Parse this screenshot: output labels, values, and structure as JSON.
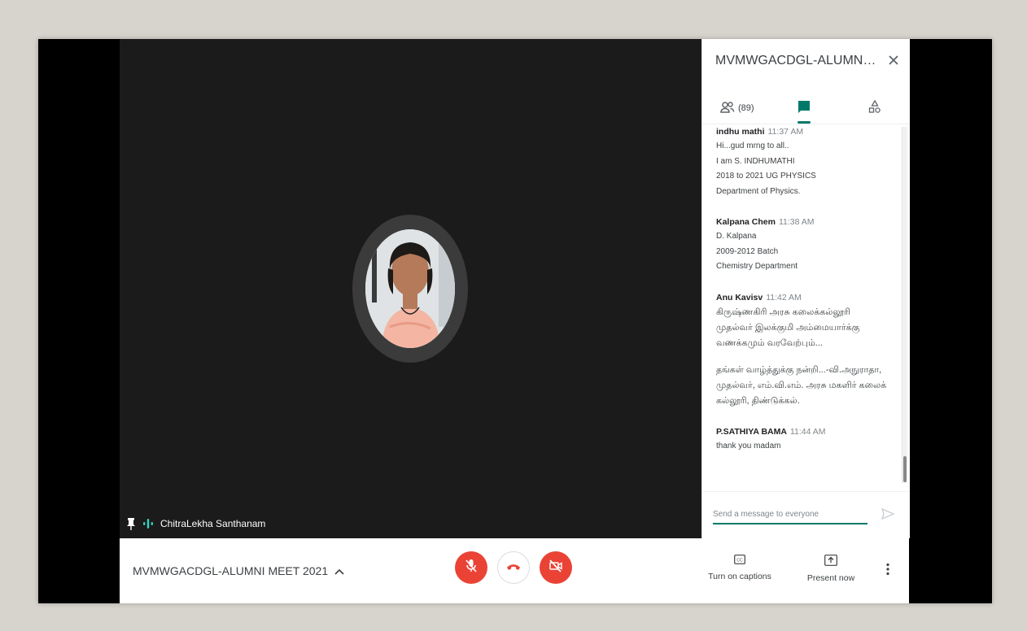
{
  "participant": {
    "name": "ChitraLekha Santhanam"
  },
  "sidebar": {
    "title": "MVMWGACDGL-ALUMNI MEET 2...",
    "people_count": "(89)",
    "compose_placeholder": "Send a message to everyone"
  },
  "messages": [
    {
      "sender": "indhu mathi",
      "time": "11:37 AM",
      "lines": [
        "Hi...gud mrng to all..",
        "I am S. INDHUMATHI",
        "2018 to 2021 UG PHYSICS",
        "Department of Physics."
      ]
    },
    {
      "sender": "Kalpana Chem",
      "time": "11:38 AM",
      "lines": [
        "D. Kalpana",
        "2009-2012 Batch",
        "Chemistry Department"
      ]
    },
    {
      "sender": "Anu Kavisv",
      "time": "11:42 AM",
      "lines": [
        "கிருஷ்ணகிரி அரசு கலைக்கல்லூரி",
        "முதல்வர் இலக்குமி அம்மையார்க்கு",
        "வணக்கமும் வரவேற்பும்..."
      ],
      "lines2": [
        "தங்கள் வாழ்த்துக்கு நன்றி...-வி.அநுராதா,",
        "முதல்வர், எம்.வி.எம். அரசு மகளிர் கலைக்",
        "கல்லூரி, திண்டுக்கல்."
      ]
    },
    {
      "sender": "P.SATHIYA BAMA",
      "time": "11:44 AM",
      "lines": [
        "thank you madam"
      ]
    }
  ],
  "bottom_bar": {
    "meeting_title": "MVMWGACDGL-ALUMNI MEET 2021",
    "captions_label": "Turn on captions",
    "present_label": "Present now"
  },
  "colors": {
    "accent": "#00796b",
    "danger": "#ea4335",
    "video_bg": "#1b1b1b"
  },
  "icons": [
    "pin-icon",
    "audio-level-icon",
    "close-icon",
    "people-icon",
    "chat-icon",
    "activities-icon",
    "send-icon",
    "chevron-up-icon",
    "mic-off-icon",
    "hang-up-icon",
    "camera-off-icon",
    "captions-icon",
    "present-icon",
    "more-vert-icon"
  ]
}
